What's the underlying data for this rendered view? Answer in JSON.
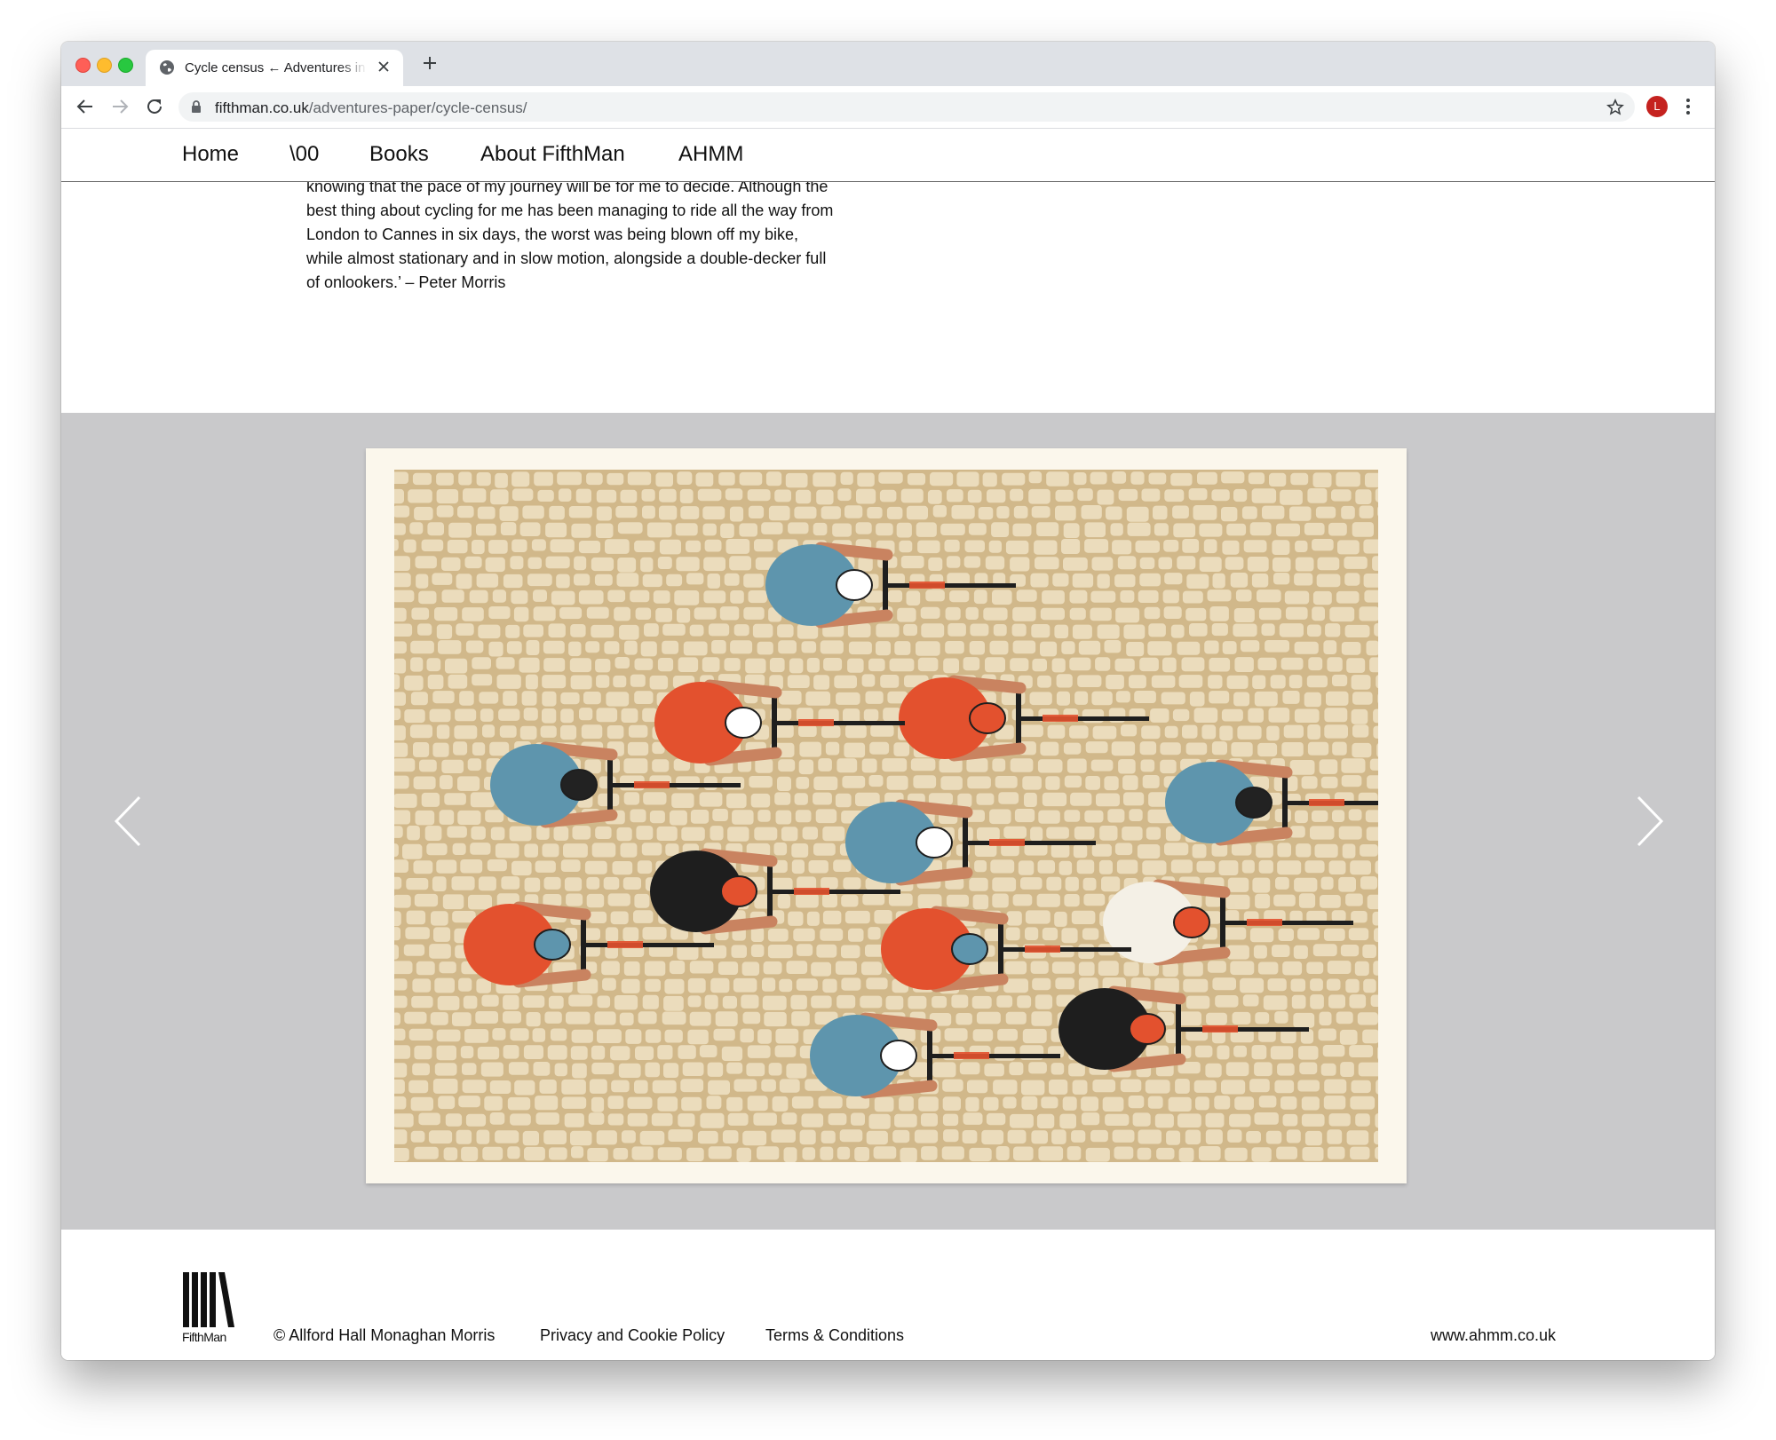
{
  "browser": {
    "tab_title": "Cycle census ← Adventures in paper",
    "url_host": "fifthman.co.uk",
    "url_path": "/adventures-paper/cycle-census/",
    "profile_initial": "L",
    "icons": [
      "globe-icon",
      "close-icon",
      "plus-icon",
      "back-arrow-icon",
      "forward-arrow-icon",
      "reload-icon",
      "lock-icon",
      "star-icon",
      "more-vert-icon"
    ]
  },
  "nav": {
    "items": [
      {
        "label": "Home"
      },
      {
        "label": "\\00"
      },
      {
        "label": "Books"
      },
      {
        "label": "About FifthMan"
      },
      {
        "label": "AHMM"
      }
    ]
  },
  "article": {
    "quote_lines": [
      "knowing that the pace of my journey will be for me to decide. Although the",
      "best thing about cycling for me has been managing to ride all the way from",
      "London to Cannes in six days, the worst was being blown off my bike,",
      "while almost stationary and in slow motion, alongside a double-decker full",
      "of onlookers.’ – Peter Morris"
    ]
  },
  "gallery": {
    "image_alt": "Illustration of cyclists riding over cobblestones, seen from above",
    "prev_icon": "chevron-left-icon",
    "next_icon": "chevron-right-icon",
    "colors": {
      "background": "#c9c9cb",
      "cobble_ground": "#d1b88a",
      "cobble_stone": "#ebdcbc",
      "jersey_blue": "#5e95ad",
      "jersey_red": "#e3512e",
      "jersey_black": "#1e1e1e",
      "skin": "#c98360"
    }
  },
  "footer": {
    "logo_text": "FifthMan",
    "copyright": "© Allford Hall Monaghan Morris",
    "privacy": "Privacy and Cookie Policy",
    "terms": "Terms & Conditions",
    "website": "www.ahmm.co.uk"
  }
}
